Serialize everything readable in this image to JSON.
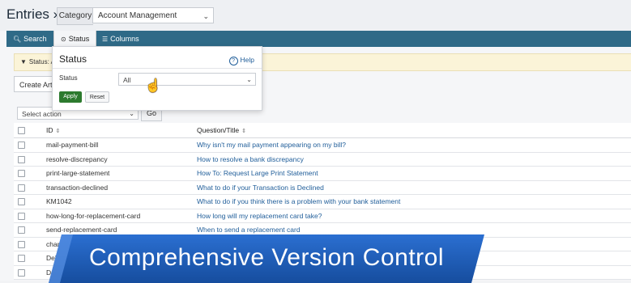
{
  "header": {
    "title": "Entries »",
    "category_label": "Category",
    "category_value": "Account Management"
  },
  "toolbar": {
    "search": "Search",
    "status": "Status",
    "columns": "Columns"
  },
  "filterbar": {
    "text": "Status: A"
  },
  "create_button": "Create Artic",
  "actions": {
    "select_placeholder": "Select action",
    "go": "Go"
  },
  "table": {
    "headers": {
      "id": "ID",
      "title": "Question/Title",
      "sort_glyph": "⇕"
    },
    "rows": [
      {
        "id": "mail-payment-bill",
        "title": "Why isn't my mail payment appearing on my bill?"
      },
      {
        "id": "resolve-discrepancy",
        "title": "How to resolve a bank discrepancy"
      },
      {
        "id": "print-large-statement",
        "title": "How To: Request Large Print Statement"
      },
      {
        "id": "transaction-declined",
        "title": "What to do if your Transaction is Declined"
      },
      {
        "id": "KM1042",
        "title": "What to do if you think there is a problem with your bank statement"
      },
      {
        "id": "how-long-for-replacement-card",
        "title": "How long will my replacement card take?"
      },
      {
        "id": "send-replacement-card",
        "title": "When to send a replacement card"
      },
      {
        "id": "chan",
        "title": ""
      },
      {
        "id": "Del",
        "title": ""
      },
      {
        "id": "D",
        "title": ""
      }
    ]
  },
  "status_panel": {
    "title": "Status",
    "help": "Help",
    "label": "Status",
    "selected": "All",
    "apply": "Apply",
    "reset": "Reset"
  },
  "banner": {
    "text": "Comprehensive Version Control",
    "color": "#1e5bb5"
  }
}
